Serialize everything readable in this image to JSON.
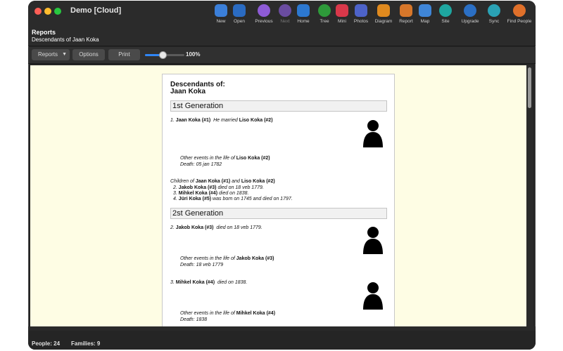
{
  "window": {
    "title": "Demo [Cloud]"
  },
  "breadcrumb": {
    "section": "Reports",
    "report_name": "Descendants of Jaan Koka"
  },
  "toolbar": {
    "buttons": [
      {
        "label": "New",
        "icon": "new-document-icon",
        "color": "#3b7fd9"
      },
      {
        "label": "Open",
        "icon": "folder-icon",
        "color": "#2a6bc2"
      },
      {
        "label": "Previous",
        "icon": "previous-icon",
        "color": "#8e5bd6"
      },
      {
        "label": "Next",
        "icon": "next-icon",
        "color": "#6a4ca0"
      },
      {
        "label": "Home",
        "icon": "home-icon",
        "color": "#2c78d0"
      },
      {
        "label": "Tree",
        "icon": "tree-icon",
        "color": "#2e9a3a"
      },
      {
        "label": "Mini",
        "icon": "tag-icon",
        "color": "#d9384a"
      },
      {
        "label": "Photos",
        "icon": "photos-icon",
        "color": "#4d63c9"
      },
      {
        "label": "Diagram",
        "icon": "diagram-icon",
        "color": "#e08a1e"
      },
      {
        "label": "Report",
        "icon": "report-icon",
        "color": "#d7772a"
      },
      {
        "label": "Map",
        "icon": "map-icon",
        "color": "#3f86d8"
      },
      {
        "label": "Site",
        "icon": "globe-icon",
        "color": "#1ea6a0"
      },
      {
        "label": "Upgrade",
        "icon": "upgrade-icon",
        "color": "#2b6fc4"
      },
      {
        "label": "Sync",
        "icon": "sync-icon",
        "color": "#2aa2b5"
      },
      {
        "label": "Find People",
        "icon": "find-people-icon",
        "color": "#e0702a"
      }
    ]
  },
  "subbar": {
    "reports_label": "Reports",
    "options_label": "Options",
    "print_label": "Print",
    "zoom_value": 0.45,
    "zoom_label": "100%"
  },
  "document": {
    "title_line1": "Descendants of:",
    "title_line2": "Jaan Koka",
    "gen1_header": "1st Generation",
    "gen2_header": "2st Generation",
    "e1_num": "1.",
    "e1_name": "Jaan Koka (#1)",
    "e1_mid": "He married",
    "e1_spouse": "Liso Koka (#2)",
    "e1_events_prefix": "Other events in the life of",
    "e1_events_name": "Liso Koka (#2)",
    "e1_death": "Death: 05 jan 1782",
    "children_prefix": "Children of",
    "children_parent1": "Jaan Koka (#1)",
    "children_and": "and",
    "children_parent2": "Liso Koka (#2)",
    "c1_num": "2.",
    "c1_name": "Jakob Koka (#3)",
    "c1_text": "died on 18 veb 1779.",
    "c2_num": "3.",
    "c2_name": "Mihkel Koka (#4)",
    "c2_text": "died on 1838.",
    "c3_num": "4.",
    "c3_name": "Jüri Koka (#5)",
    "c3_text": "was born on 1745 and died on 1797.",
    "e2_num": "2.",
    "e2_name": "Jakob Koka (#3)",
    "e2_text": "died on 18 veb 1779.",
    "e2_events_prefix": "Other events in the life of",
    "e2_events_name": "Jakob Koka (#3)",
    "e2_death": "Death: 18 veb 1779",
    "e3_num": "3.",
    "e3_name": "Mihkel Koka (#4)",
    "e3_text": "died on 1838.",
    "e3_events_prefix": "Other events in the life of",
    "e3_events_name": "Mihkel Koka (#4)",
    "e3_death": "Death: 1838"
  },
  "status": {
    "people": "People: 24",
    "families": "Families: 9"
  }
}
